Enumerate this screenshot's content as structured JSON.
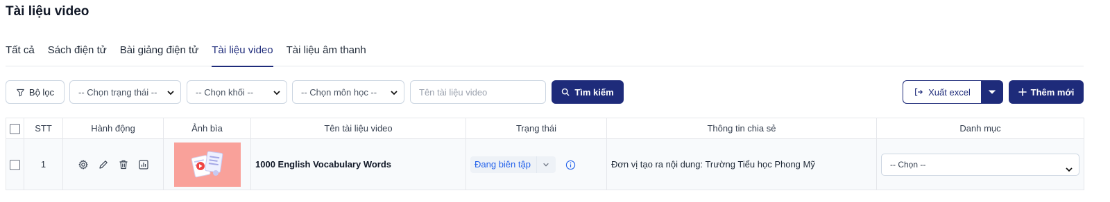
{
  "page": {
    "title": "Tài liệu video"
  },
  "tabs": [
    {
      "label": "Tất cả"
    },
    {
      "label": "Sách điện tử"
    },
    {
      "label": "Bài giảng điện tử"
    },
    {
      "label": "Tài liệu video",
      "active": true
    },
    {
      "label": "Tài liệu âm thanh"
    }
  ],
  "toolbar": {
    "filter_label": "Bộ lọc",
    "status_select": "-- Chọn trạng thái --",
    "grade_select": "-- Chọn khối --",
    "subject_select": "-- Chọn môn học --",
    "search_placeholder": "Tên tài liệu video",
    "search_label": "Tìm kiếm",
    "export_label": "Xuất excel",
    "add_label": "Thêm mới"
  },
  "table": {
    "columns": [
      "STT",
      "Hành động",
      "Ảnh bìa",
      "Tên tài liệu video",
      "Trạng thái",
      "Thông tin chia sẻ",
      "Danh mục"
    ],
    "rows": [
      {
        "index": "1",
        "name": "1000 English Vocabulary Words",
        "status": "Đang biên tập",
        "share_info": "Đơn vị tạo ra nội dung: Trường Tiểu học Phong Mỹ",
        "category": "-- Chọn --"
      }
    ]
  },
  "colors": {
    "primary": "#1e2b7a",
    "thumb_bg": "#f9a19a",
    "status_text": "#2563eb"
  },
  "icons": [
    "filter-icon",
    "chevron-down-icon",
    "search-icon",
    "export-icon",
    "plus-icon",
    "gear-icon",
    "pencil-icon",
    "trash-icon",
    "chart-icon",
    "info-icon"
  ]
}
